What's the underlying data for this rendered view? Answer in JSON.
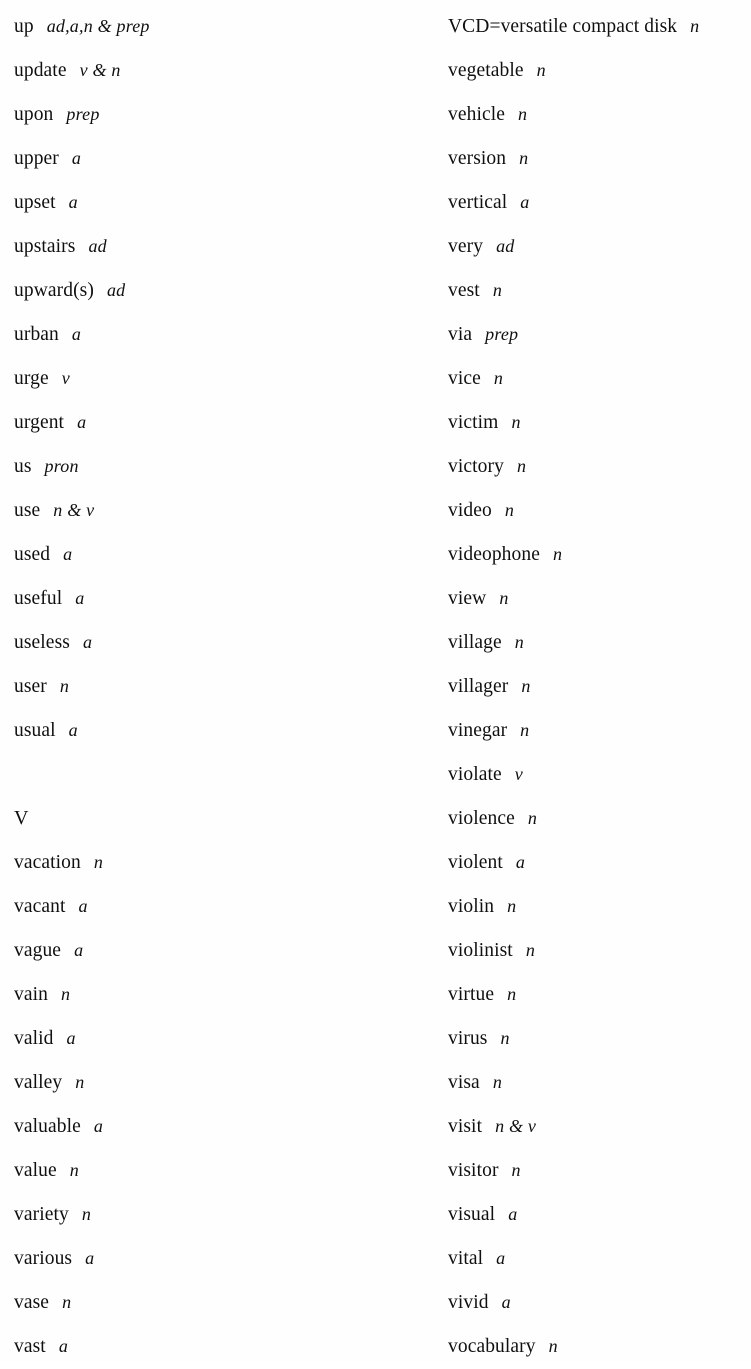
{
  "page": {
    "type": "vocabulary-word-list",
    "background_color": "#fefefe",
    "text_color": "#101010",
    "columns": 2
  },
  "left_column": {
    "entries": [
      {
        "word": "up",
        "pos": "ad,a,n & prep"
      },
      {
        "word": "update",
        "pos": "v & n"
      },
      {
        "word": "upon",
        "pos": "prep"
      },
      {
        "word": "upper",
        "pos": "a"
      },
      {
        "word": "upset",
        "pos": "a"
      },
      {
        "word": "upstairs",
        "pos": "ad"
      },
      {
        "word": "upward(s)",
        "pos": "ad"
      },
      {
        "word": "urban",
        "pos": "a"
      },
      {
        "word": "urge",
        "pos": "v"
      },
      {
        "word": "urgent",
        "pos": "a"
      },
      {
        "word": "us",
        "pos": "pron"
      },
      {
        "word": "use",
        "pos": "n & v"
      },
      {
        "word": "used",
        "pos": "a"
      },
      {
        "word": "useful",
        "pos": "a"
      },
      {
        "word": "useless",
        "pos": "a"
      },
      {
        "word": "user",
        "pos": "n"
      },
      {
        "word": "usual",
        "pos": "a"
      },
      {
        "word": "",
        "pos": "",
        "kind": "spacer"
      },
      {
        "word": "V",
        "pos": "",
        "kind": "section"
      },
      {
        "word": "vacation",
        "pos": "n"
      },
      {
        "word": "vacant",
        "pos": "a"
      },
      {
        "word": "vague",
        "pos": "a"
      },
      {
        "word": "vain",
        "pos": "n"
      },
      {
        "word": "valid",
        "pos": "a"
      },
      {
        "word": "valley",
        "pos": "n"
      },
      {
        "word": "valuable",
        "pos": "a"
      },
      {
        "word": "value",
        "pos": "n"
      },
      {
        "word": "variety",
        "pos": "n"
      },
      {
        "word": "various",
        "pos": "a"
      },
      {
        "word": "vase",
        "pos": "n"
      },
      {
        "word": "vast",
        "pos": "a"
      }
    ]
  },
  "right_column": {
    "entries": [
      {
        "word": "VCD=versatile compact disk",
        "pos": "n"
      },
      {
        "word": "vegetable",
        "pos": "n"
      },
      {
        "word": "vehicle",
        "pos": "n"
      },
      {
        "word": "version",
        "pos": "n"
      },
      {
        "word": "vertical",
        "pos": "a"
      },
      {
        "word": "very",
        "pos": "ad"
      },
      {
        "word": "vest",
        "pos": "n"
      },
      {
        "word": "via",
        "pos": "prep"
      },
      {
        "word": "vice",
        "pos": "n"
      },
      {
        "word": "victim",
        "pos": "n"
      },
      {
        "word": "victory",
        "pos": "n"
      },
      {
        "word": "video",
        "pos": "n"
      },
      {
        "word": "videophone",
        "pos": "n"
      },
      {
        "word": "view",
        "pos": "n"
      },
      {
        "word": "village",
        "pos": "n"
      },
      {
        "word": "villager",
        "pos": "n"
      },
      {
        "word": "vinegar",
        "pos": "n"
      },
      {
        "word": "violate",
        "pos": "v"
      },
      {
        "word": "violence",
        "pos": "n"
      },
      {
        "word": "violent",
        "pos": "a"
      },
      {
        "word": "violin",
        "pos": "n"
      },
      {
        "word": "violinist",
        "pos": "n"
      },
      {
        "word": "virtue",
        "pos": "n"
      },
      {
        "word": "virus",
        "pos": "n"
      },
      {
        "word": "visa",
        "pos": "n"
      },
      {
        "word": "visit",
        "pos": "n & v"
      },
      {
        "word": "visitor",
        "pos": "n"
      },
      {
        "word": "visual",
        "pos": "a"
      },
      {
        "word": "vital",
        "pos": "a"
      },
      {
        "word": "vivid",
        "pos": "a"
      },
      {
        "word": "vocabulary",
        "pos": "n"
      }
    ]
  }
}
